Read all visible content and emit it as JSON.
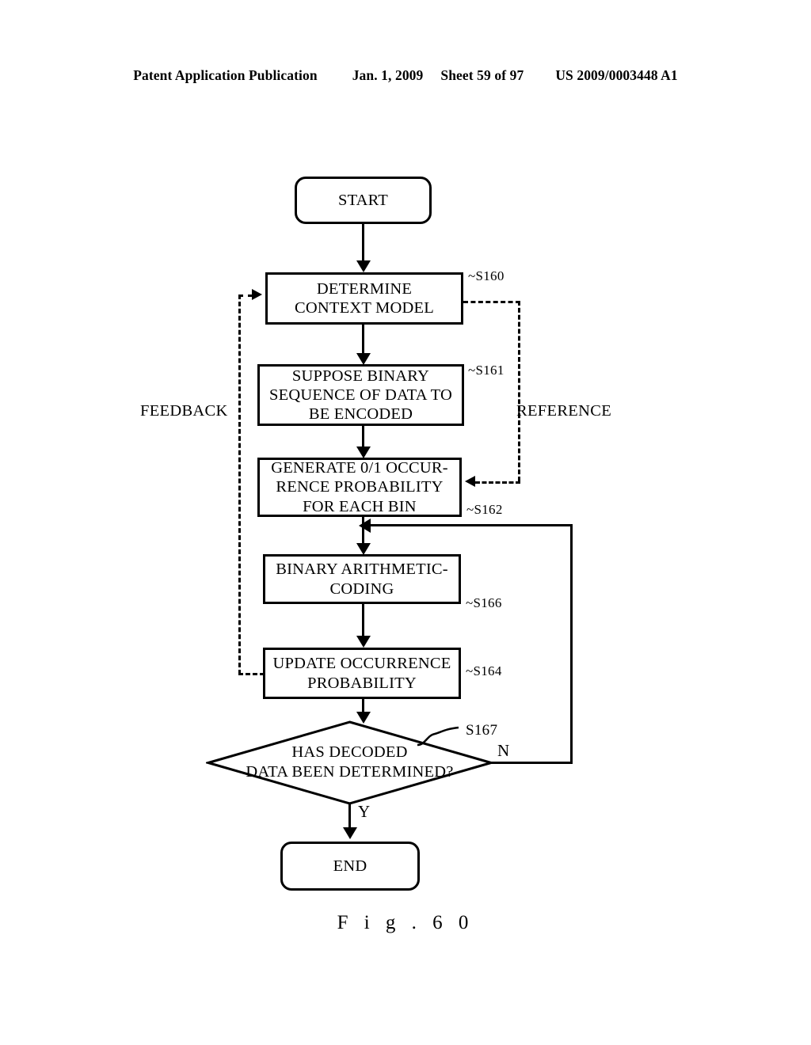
{
  "header": {
    "publication": "Patent Application Publication",
    "date": "Jan. 1, 2009",
    "sheet": "Sheet 59 of 97",
    "patent_number": "US 2009/0003448 A1"
  },
  "figure": {
    "caption": "F i g .   6 0"
  },
  "flowchart": {
    "start": {
      "label": "START"
    },
    "end": {
      "label": "END"
    },
    "steps": [
      {
        "id": "S160",
        "tag": "~S160",
        "line1": "DETERMINE",
        "line2": "CONTEXT MODEL",
        "line3": ""
      },
      {
        "id": "S161",
        "tag": "~S161",
        "line1": "SUPPOSE BINARY",
        "line2": "SEQUENCE OF DATA TO",
        "line3": "BE ENCODED"
      },
      {
        "id": "S162",
        "tag": "~S162",
        "line1": "GENERATE 0/1 OCCUR-",
        "line2": "RENCE PROBABILITY",
        "line3": "FOR EACH BIN"
      },
      {
        "id": "S166",
        "tag": "~S166",
        "line1": "BINARY ARITHMETIC-",
        "line2": "CODING",
        "line3": ""
      },
      {
        "id": "S164",
        "tag": "~S164",
        "line1": "UPDATE OCCURRENCE",
        "line2": "PROBABILITY",
        "line3": ""
      }
    ],
    "decision": {
      "id": "S167",
      "tag": "S167",
      "line1": "HAS DECODED",
      "line2": "DATA BEEN DETERMINED?",
      "yes_label": "Y",
      "no_label": "N"
    },
    "annotations": {
      "feedback": "FEEDBACK",
      "reference": "REFERENCE"
    }
  },
  "colors": {
    "ink": "#000000",
    "paper": "#ffffff"
  }
}
